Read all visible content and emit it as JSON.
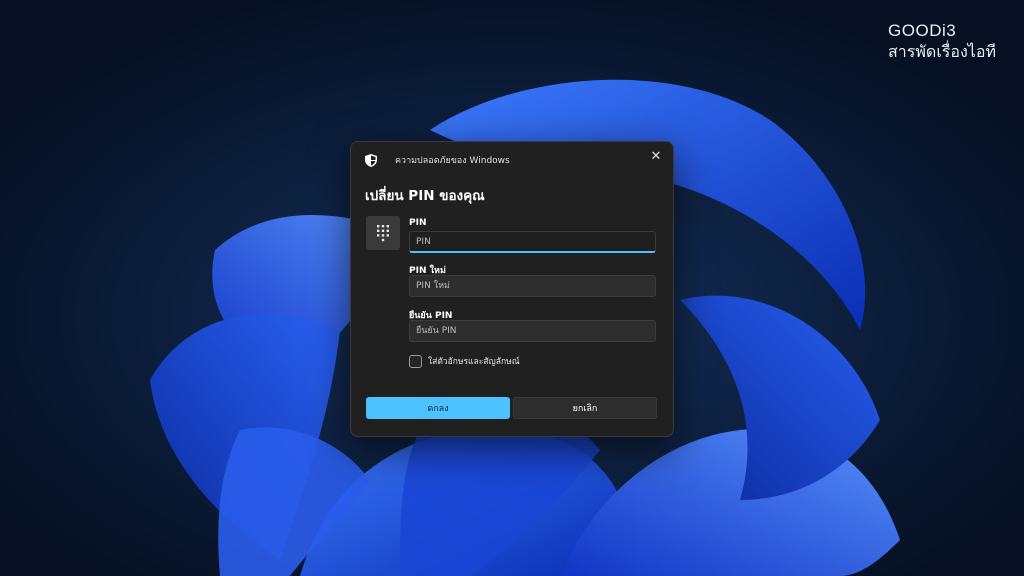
{
  "watermark": {
    "line1": "GOODi3",
    "line2": "สารพัดเรื่องไอที"
  },
  "dialog": {
    "window_title": "ความปลอดภัยของ Windows",
    "close_glyph": "✕",
    "heading": "เปลี่ยน PIN ของคุณ",
    "pin": {
      "label": "PIN",
      "placeholder": "PIN"
    },
    "new_pin": {
      "label": "PIN ใหม่",
      "placeholder": "PIN ใหม่"
    },
    "confirm_pin": {
      "label": "ยืนยัน PIN",
      "placeholder": "ยืนยัน PIN"
    },
    "include_chars_label": "ใส่ตัวอักษรและสัญลักษณ์",
    "ok_label": "ตกลง",
    "cancel_label": "ยกเลิก"
  },
  "colors": {
    "accent": "#4cc2ff",
    "dialog_bg": "#202020",
    "wallpaper_blue": "#1d4fe0"
  },
  "icons": [
    "shield-icon",
    "close-icon",
    "keypad-icon"
  ]
}
